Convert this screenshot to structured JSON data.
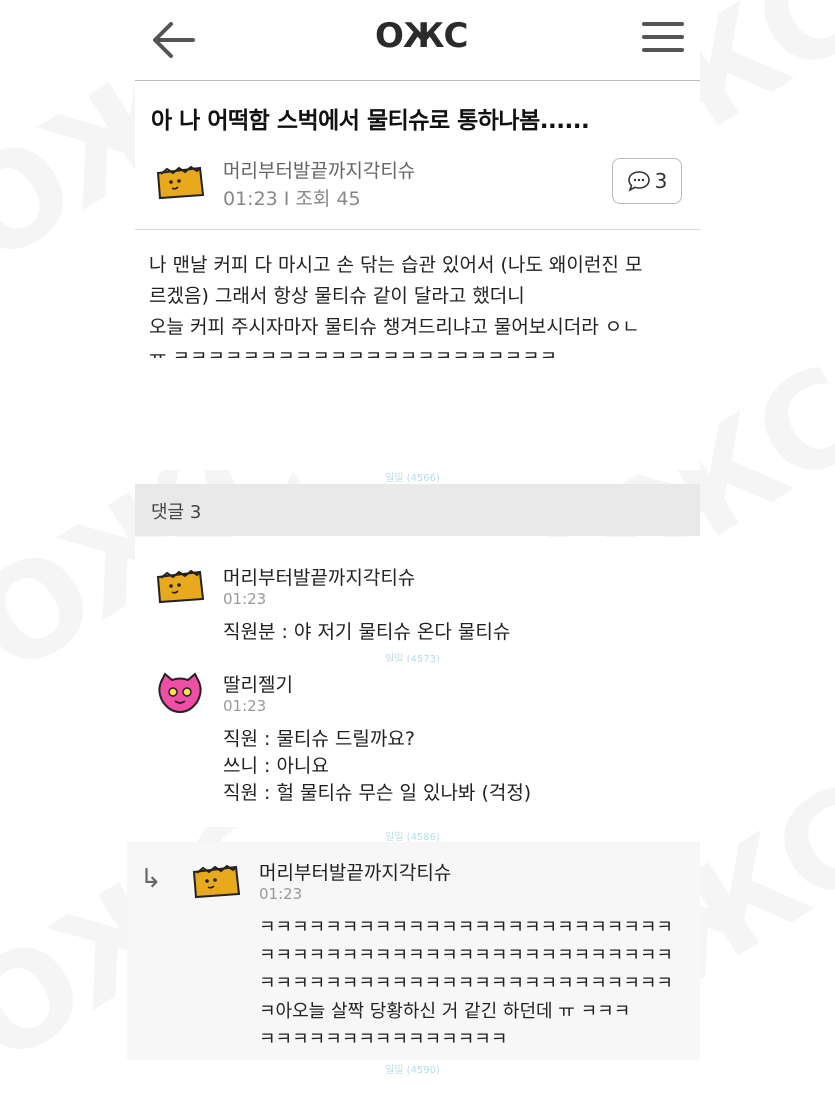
{
  "header": {
    "logo": "OЖC",
    "back_label": "back",
    "menu_label": "menu"
  },
  "post": {
    "title": "아 나 어떡함 스벅에서 물티슈로 통하나봄......",
    "author": "머리부터발끝까지각티슈",
    "time": "01:23",
    "views": "조회 45",
    "comment_count": "3",
    "body_lines": [
      "나 맨날 커피 다 마시고 손 닦는 습관 있어서 (나도 왜이런진 모",
      "르겠음) 그래서 항상 물티슈 같이 달라고 했더니",
      "오늘 커피 주시자마자 물티슈 챙겨드리냐고 물어보시더라 ㅇㄴ",
      "ㅠ ㅋㅋㅋㅋㅋㅋㅋㅋㅋㅋㅋㅋㅋㅋㅋㅋㅋㅋㅋㅋㅋㅋ"
    ]
  },
  "comments_header": "댓글 3",
  "comments": [
    {
      "author": "머리부터발끝까지각티슈",
      "time": "01:23",
      "text": "직원분 : 야 저기 물티슈 온다 물티슈"
    },
    {
      "author": "딸리젤기",
      "time": "01:23",
      "text": "직원 : 물티슈 드릴까요?\n쓰니 : 아니요\n직원 : 헐 물티슈 무슨 일 있나봐 (걱정)"
    },
    {
      "author": "머리부터발끝까지각티슈",
      "time": "01:23",
      "text": "ㅋㅋㅋㅋㅋㅋㅋㅋㅋㅋㅋㅋㅋㅋㅋㅋㅋㅋㅋㅋㅋㅋㅋㅋㅋ\nㅋㅋㅋㅋㅋㅋㅋㅋㅋㅋㅋㅋㅋㅋㅋㅋㅋㅋㅋㅋㅋㅋㅋㅋㅋ\nㅋㅋㅋㅋㅋㅋㅋㅋㅋㅋㅋㅋㅋㅋㅋㅋㅋㅋㅋㅋㅋㅋㅋㅋㅋ\nㅋ아오늘 살짝 당황하신 거 같긴 하던데 ㅠ ㅋㅋㅋ\nㅋㅋㅋㅋㅋㅋㅋㅋㅋㅋㅋㅋㅋㅋㅋ",
      "is_reply": true
    }
  ],
  "ad_labels": [
    "일밀 (4566)",
    "일밀 (4573)",
    "일밀 (4586)",
    "일밀 (4590)"
  ],
  "colors": {
    "tissue_box": "#e9a91c",
    "cat_face": "#ee4fa4",
    "comments_header_bg": "#e9e9e9",
    "ad_label": "#b6dde8"
  }
}
